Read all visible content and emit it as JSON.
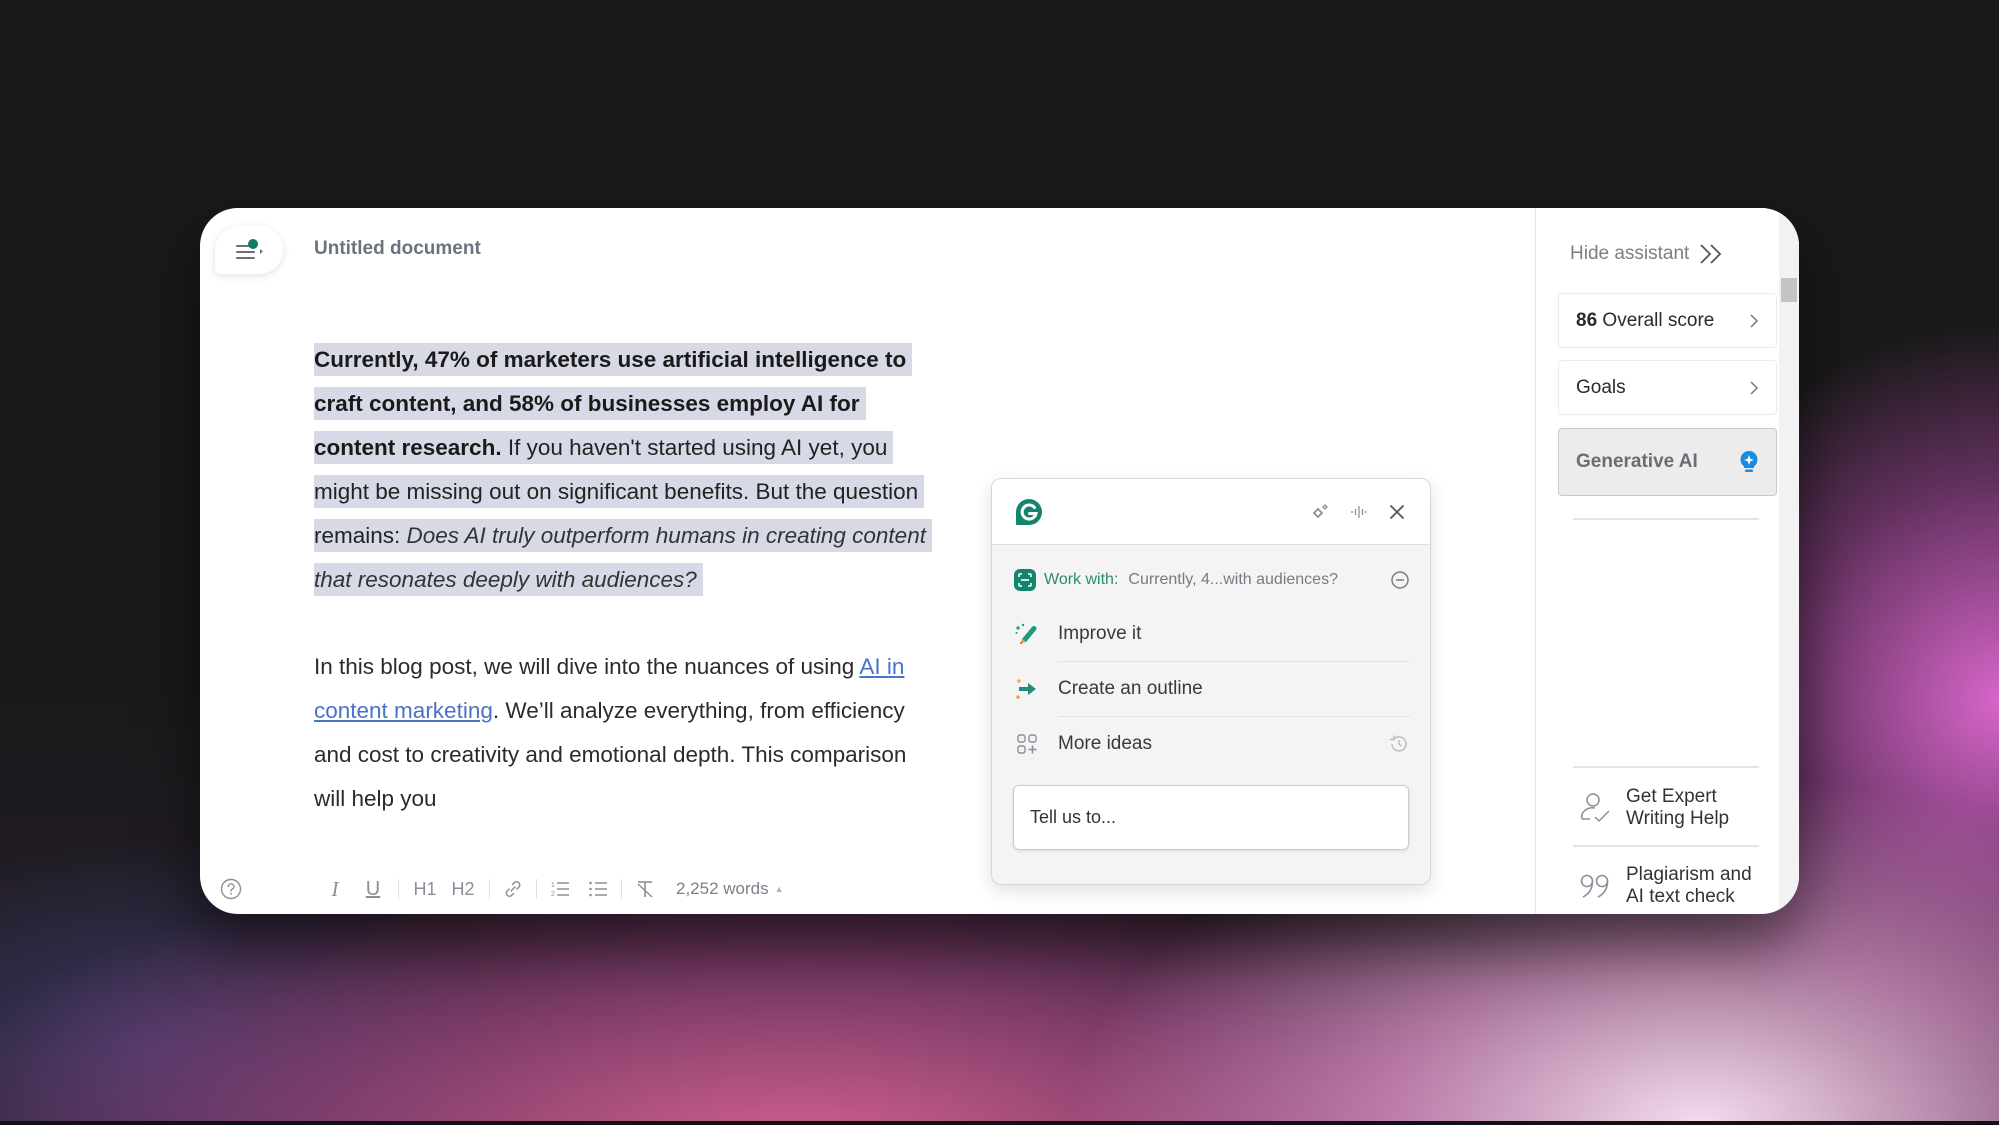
{
  "document": {
    "title": "Untitled document",
    "paragraph1": {
      "bold_text": "Currently, 47% of marketers use artificial intelligence to craft content, and 58% of businesses employ AI for content research.",
      "normal_text": " If you haven't started using AI yet, you might be missing out on significant benefits. But the question remains: ",
      "italic_text": "Does AI truly outperform humans in creating content that resonates deeply with audiences?"
    },
    "paragraph2": {
      "text_before_link": "In this blog post, we will dive into the nuances of using ",
      "link_text": "AI in content marketing",
      "text_after_link": ". We’ll analyze everything, from efficiency and cost to creativity and emotional depth. This comparison will help you"
    }
  },
  "toolbar": {
    "help_icon": "question-circle-icon",
    "buttons": [
      {
        "name": "italic",
        "label": "I"
      },
      {
        "name": "underline",
        "label": "U"
      },
      {
        "name": "heading-1",
        "label": "H1"
      },
      {
        "name": "heading-2",
        "label": "H2"
      },
      {
        "name": "link",
        "icon": "link-icon"
      },
      {
        "name": "numbered-list",
        "icon": "numbered-list-icon"
      },
      {
        "name": "bulleted-list",
        "icon": "bulleted-list-icon"
      },
      {
        "name": "clear-formatting",
        "icon": "clear-formatting-icon"
      }
    ],
    "h1": "H1",
    "h2": "H2",
    "italic": "I",
    "underline": "U",
    "word_count": "2,252 words"
  },
  "assistant_popup": {
    "work_with_label": "Work with:",
    "work_with_value": "Currently, 4...with audiences?",
    "items": [
      {
        "label": "Improve it",
        "icon": "pencil-sparkle-icon"
      },
      {
        "label": "Create an outline",
        "icon": "arrow-sparkle-icon"
      },
      {
        "label": "More ideas",
        "icon": "grid-plus-icon"
      }
    ],
    "input_placeholder": "Tell us to...",
    "brand_color": "#15846d"
  },
  "sidebar": {
    "hide_assistant": "Hide assistant",
    "score_value": "86",
    "score_label": "Overall score",
    "goals_label": "Goals",
    "generative_ai_label": "Generative AI",
    "expert_help": [
      "Get Expert",
      "Writing Help"
    ],
    "plagiarism": [
      "Plagiarism and",
      "AI text check"
    ],
    "accent_color": "#1a8be0"
  }
}
